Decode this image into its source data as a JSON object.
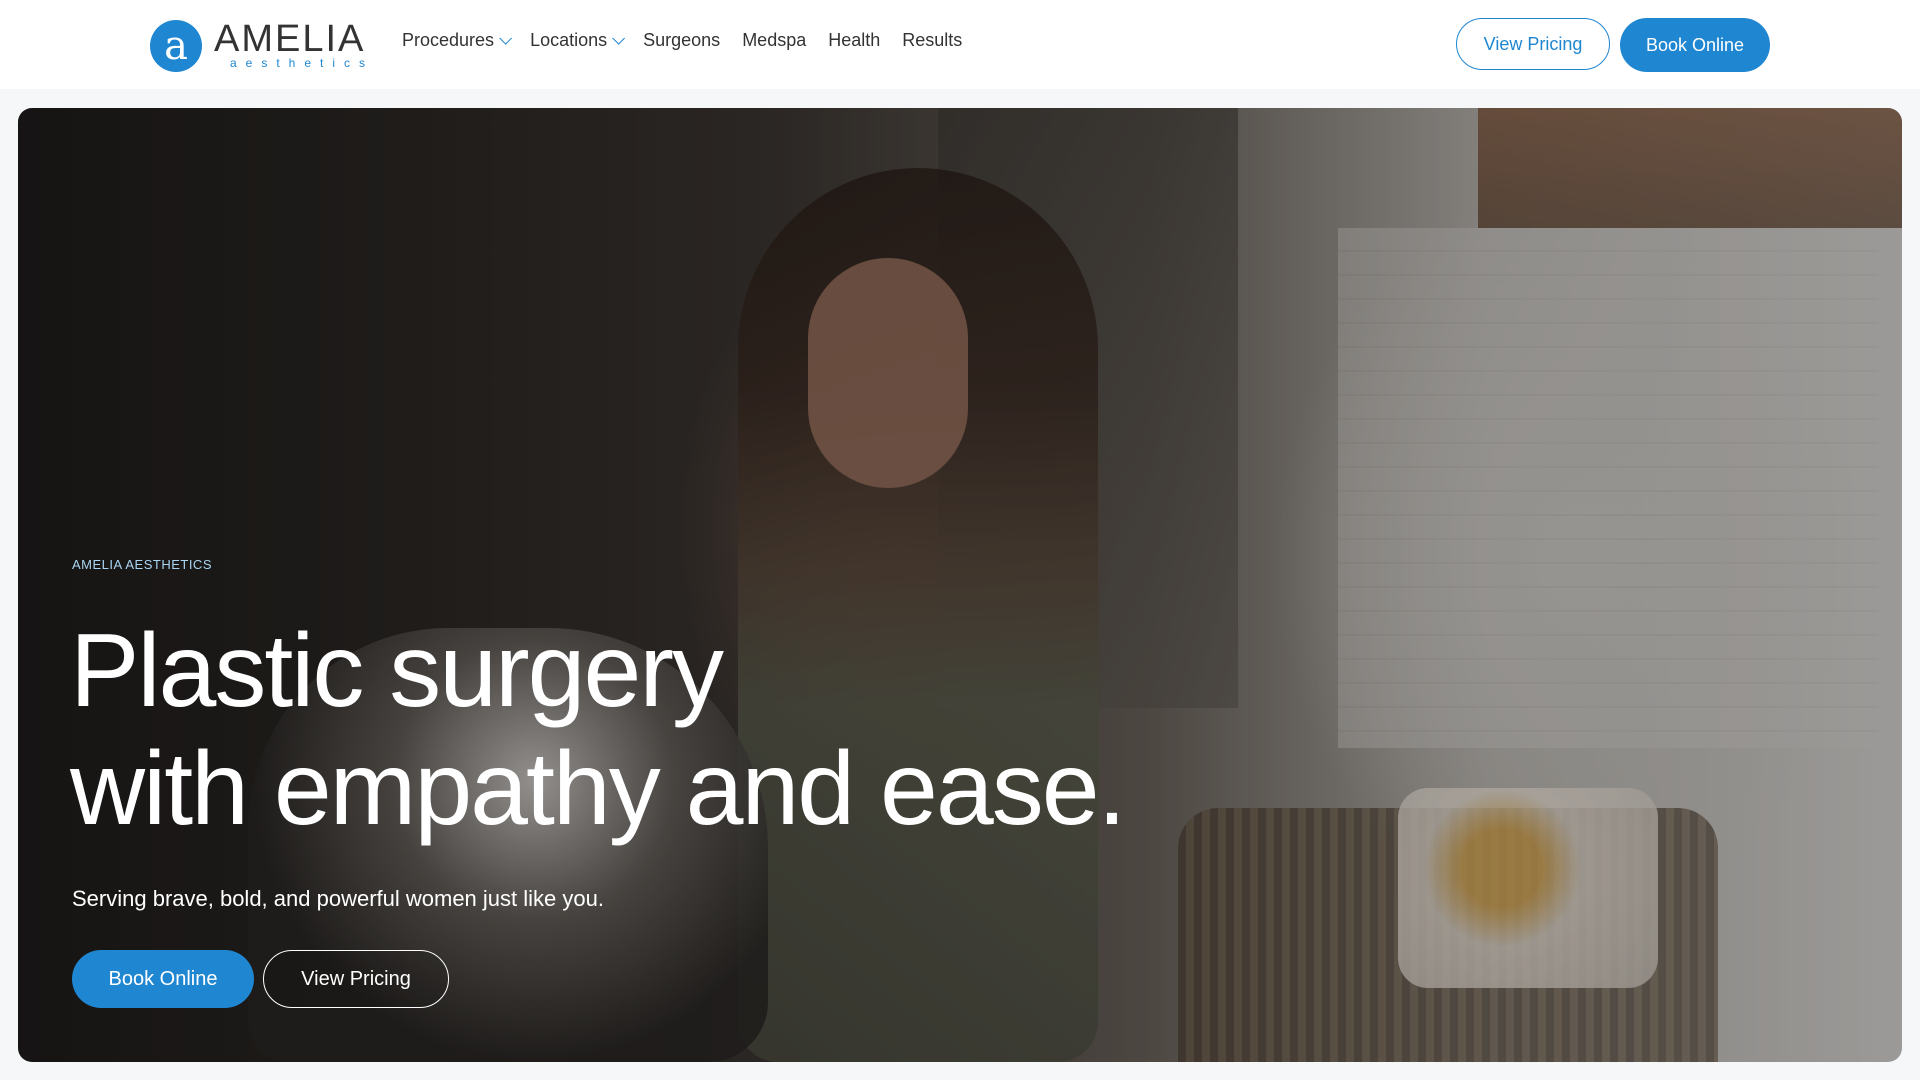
{
  "header": {
    "logo": {
      "wordmark": "AMELIA",
      "subline": "aesthetics",
      "mark": "a"
    },
    "nav": [
      {
        "label": "Procedures",
        "dropdown": true
      },
      {
        "label": "Locations",
        "dropdown": true
      },
      {
        "label": "Surgeons",
        "dropdown": false
      },
      {
        "label": "Medspa",
        "dropdown": false
      },
      {
        "label": "Health",
        "dropdown": false
      },
      {
        "label": "Results",
        "dropdown": false
      }
    ],
    "actions": {
      "pricing_label": "View Pricing",
      "book_label": "Book Online"
    }
  },
  "hero": {
    "eyebrow": "AMELIA AESTHETICS",
    "headline_line1": "Plastic surgery",
    "headline_line2": "with empathy and ease.",
    "subline": "Serving brave, bold, and powerful women just like you.",
    "buttons": {
      "book_label": "Book Online",
      "pricing_label": "View Pricing"
    }
  },
  "colors": {
    "brand_blue": "#1f86d1",
    "eyebrow_text": "#a9d4f2"
  },
  "icons": {
    "logo_mark": "amelia-logo-icon",
    "dropdown": "chevron-down-icon"
  }
}
